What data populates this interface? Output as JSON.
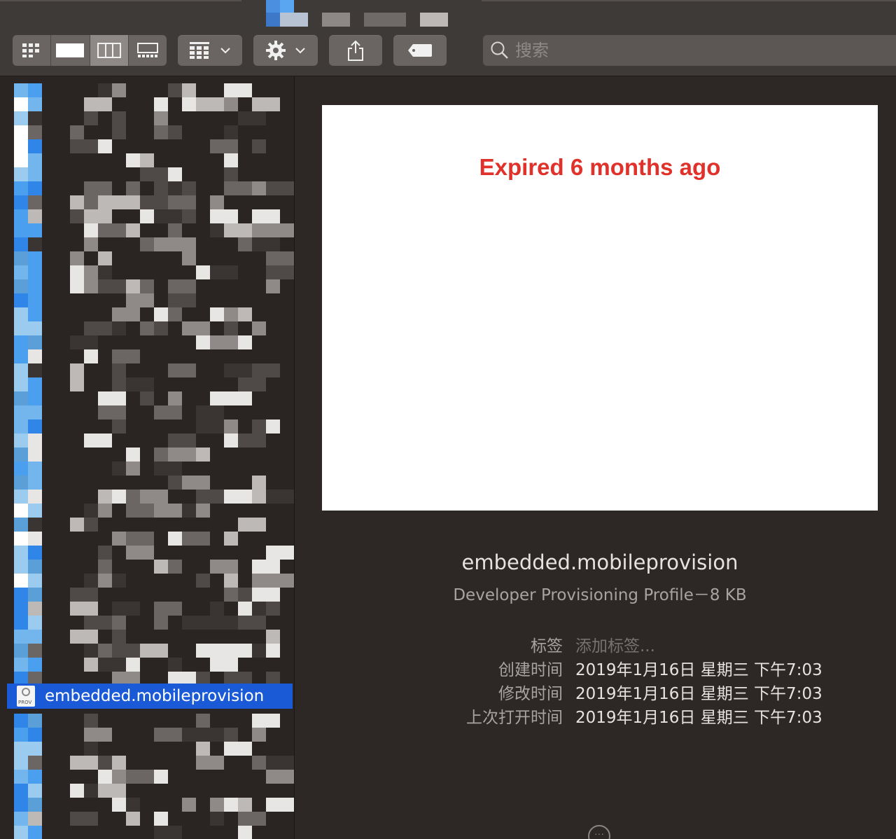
{
  "toolbar": {
    "view_buttons": [
      "icon-view",
      "list-view",
      "column-view",
      "gallery-view"
    ],
    "group_button": "group-by",
    "action_button": "action-menu",
    "share_button": "share",
    "tag_button": "edit-tags",
    "search_placeholder": "搜索"
  },
  "sidebar": {
    "selected_item": "embedded.mobileprovision",
    "selected_icon_caption": "PROV"
  },
  "preview": {
    "status": "Expired 6 months ago",
    "file_name": "embedded.mobileprovision",
    "file_kind": "Developer Provisioning Profile－8 KB",
    "metadata": [
      {
        "key": "标签",
        "value": "添加标签..."
      },
      {
        "key": "创建时间",
        "value": "2019年1月16日 星期三 下午7:03"
      },
      {
        "key": "修改时间",
        "value": "2019年1月16日 星期三 下午7:03"
      },
      {
        "key": "上次打开时间",
        "value": "2019年1月16日 星期三 下午7:03"
      }
    ]
  },
  "colors": {
    "selection": "#1a5ad6",
    "expired_red": "#e0322a",
    "background": "#2d2826"
  }
}
